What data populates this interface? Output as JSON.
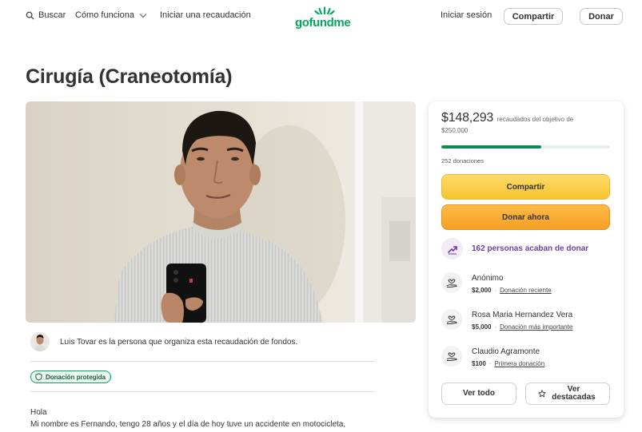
{
  "nav": {
    "search_label": "Buscar",
    "how_label": "Cómo funciona",
    "start_label": "Iniciar una recaudación",
    "logo_text": "gofundme",
    "signin_label": "Iniciar sesión",
    "share_label": "Compartir",
    "donate_label": "Donar"
  },
  "campaign": {
    "title": "Cirugía (Craneotomía)",
    "organizer_text": "Luis Tovar es la persona que organiza esta recaudación de fondos.",
    "protected_badge": "Donación protegida",
    "story_lines": [
      "Hola",
      "Mi nombre es Fernando, tengo 28 años y el día de hoy tuve un accidente en motocicleta,"
    ]
  },
  "donation_card": {
    "raised_amount": "$148,293",
    "raised_label": "recaudados del objetivo de $250,000",
    "progress_fraction": 0.593,
    "donations_count": "252 donaciones",
    "share_button": "Compartir",
    "donate_button": "Donar ahora",
    "trend_text": "162 personas acaban de donar",
    "donors": [
      {
        "name": "Anónimo",
        "amount": "$2,000",
        "tag": "Donación reciente"
      },
      {
        "name": "Rosa Maria Hernandez Vera",
        "amount": "$5,000",
        "tag": "Donación más importante"
      },
      {
        "name": "Claudio Agramonte",
        "amount": "$100",
        "tag": "Primera donación"
      }
    ],
    "see_all_button": "Ver todo",
    "see_top_button": "Ver destacadas"
  },
  "colors": {
    "brand_green": "#02a95c",
    "progress_green": "#0e8a52",
    "share_yellow": "#f8c42f",
    "donate_orange": "#f6a023",
    "trend_purple": "#6b3fa8"
  }
}
